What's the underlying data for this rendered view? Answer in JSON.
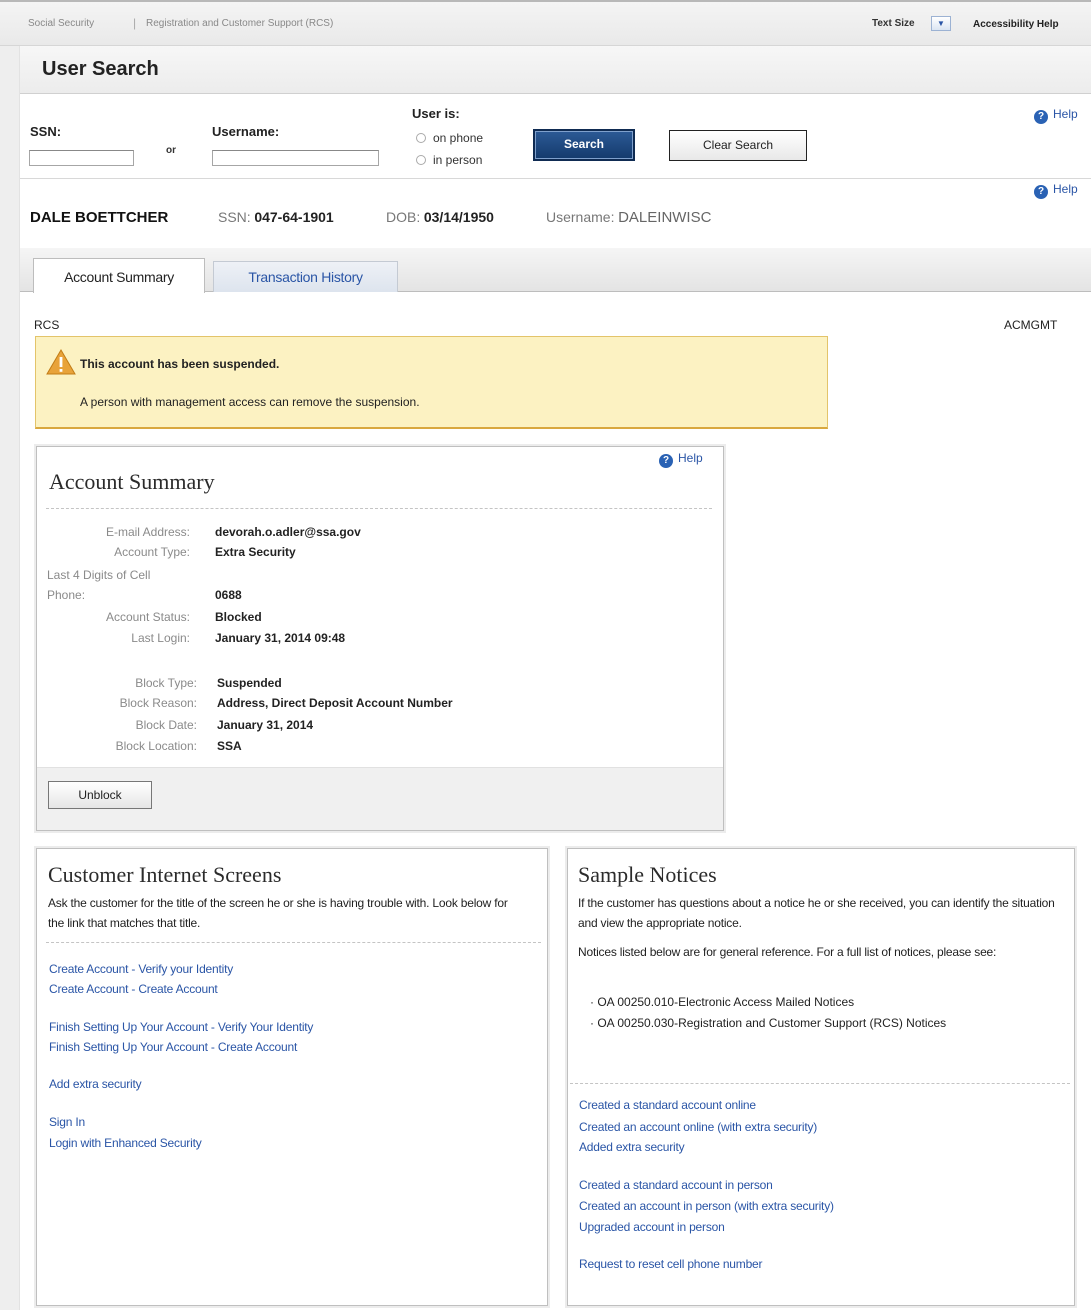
{
  "header": {
    "crumbs": [
      "Social Security",
      "Registration and Customer Support (RCS)"
    ],
    "separator": "|",
    "text_size_label": "Text Size",
    "text_size_dropdown": "▼",
    "accessibility_help": "Accessibility Help"
  },
  "page_title": "User Search",
  "search": {
    "ssn_label": "SSN:",
    "ssn_value": "",
    "or_label": "or",
    "username_label": "Username:",
    "username_value": "",
    "user_is_label": "User is:",
    "radio_options": [
      "on phone",
      "in person"
    ],
    "search_button": "Search",
    "clear_button": "Clear Search",
    "help": "Help"
  },
  "user": {
    "name": "DALE BOETTCHER",
    "ssn_label": "SSN:",
    "ssn": "047-64-1901",
    "dob_label": "DOB:",
    "dob": "03/14/1950",
    "username_label": "Username:",
    "username": "DALEINWISC",
    "help": "Help"
  },
  "tabs": [
    "Account Summary",
    "Transaction History"
  ],
  "section_left": "RCS",
  "section_right": "ACMGMT",
  "alert": {
    "title": "This account has been suspended.",
    "body": "A person with management access can remove the suspension."
  },
  "summary": {
    "title": "Account Summary",
    "help": "Help",
    "fields": [
      {
        "label": "E-mail Address:",
        "value": "devorah.o.adler@ssa.gov"
      },
      {
        "label": "Account Type:",
        "value": "Extra Security"
      },
      {
        "label": "Last 4 Digits of Cell",
        "value": ""
      },
      {
        "label": "Phone:",
        "value": "0688"
      },
      {
        "label": "Account Status:",
        "value": "Blocked"
      },
      {
        "label": "Last Login:",
        "value": "January 31, 2014 09:48"
      }
    ],
    "block_fields": [
      {
        "label": "Block Type:",
        "value": "Suspended"
      },
      {
        "label": "Block Reason:",
        "value": "Address, Direct Deposit Account Number"
      },
      {
        "label": "Block Date:",
        "value": "January 31, 2014"
      },
      {
        "label": "Block Location:",
        "value": "SSA"
      }
    ],
    "unblock_button": "Unblock"
  },
  "customer_screens": {
    "title": "Customer Internet Screens",
    "description": "Ask the customer for the title of the screen he or she is having trouble with. Look below for the link that matches that title.",
    "links": [
      "Create Account - Verify your Identity",
      "Create Account - Create Account",
      "Finish Setting Up Your Account - Verify Your Identity",
      "Finish Setting Up Your Account - Create Account",
      "Add extra security",
      "Sign In",
      "Login with Enhanced Security"
    ]
  },
  "notices": {
    "title": "Sample Notices",
    "description": "If the customer has questions about a notice he or she received, you can identify the situation and view the appropriate notice.",
    "reference": "Notices listed below are for general reference. For a full list of notices, please see:",
    "bullets": [
      "OA 00250.010-Electronic Access Mailed Notices",
      "OA 00250.030-Registration and Customer Support (RCS) Notices"
    ],
    "links": [
      "Created a standard account online",
      "Created an account online (with extra security)",
      "Added extra security",
      "Created a standard account in person",
      "Created an account in person (with extra security)",
      "Upgraded account in person",
      "Request to reset cell phone number"
    ]
  }
}
